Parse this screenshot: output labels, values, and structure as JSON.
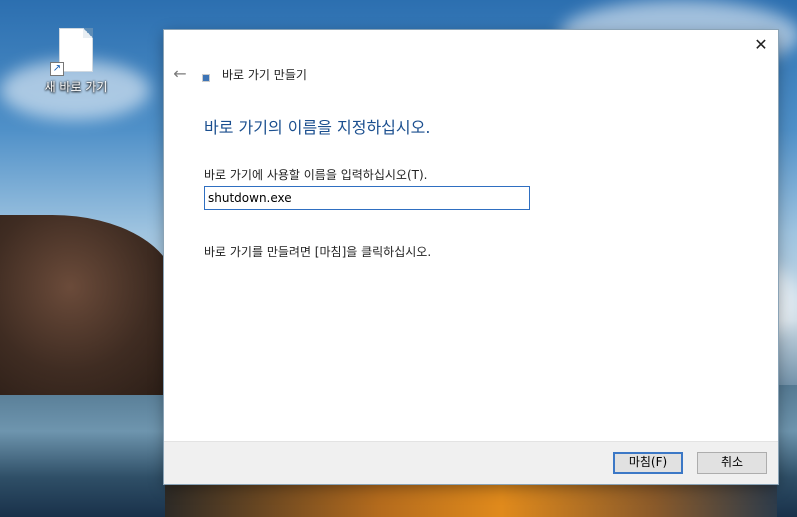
{
  "desktop": {
    "icon_label": "새 바로 가기"
  },
  "dialog": {
    "title": "바로 가기 만들기",
    "heading": "바로 가기의 이름을 지정하십시오.",
    "field_label": "바로 가기에 사용할 이름을 입력하십시오(T).",
    "name_value": "shutdown.exe",
    "hint": "바로 가기를 만들려면 [마침]을 클릭하십시오.",
    "finish_label": "마침(F)",
    "cancel_label": "취소",
    "close_glyph": "✕",
    "back_glyph": "←"
  },
  "icons": [
    "file-icon",
    "shortcut-arrow-icon",
    "back-arrow-icon",
    "close-icon",
    "shortcut-title-icon"
  ],
  "colors": {
    "heading": "#1b4f8f",
    "input_border": "#2f6fc1",
    "footer_bg": "#f0f0f0"
  }
}
